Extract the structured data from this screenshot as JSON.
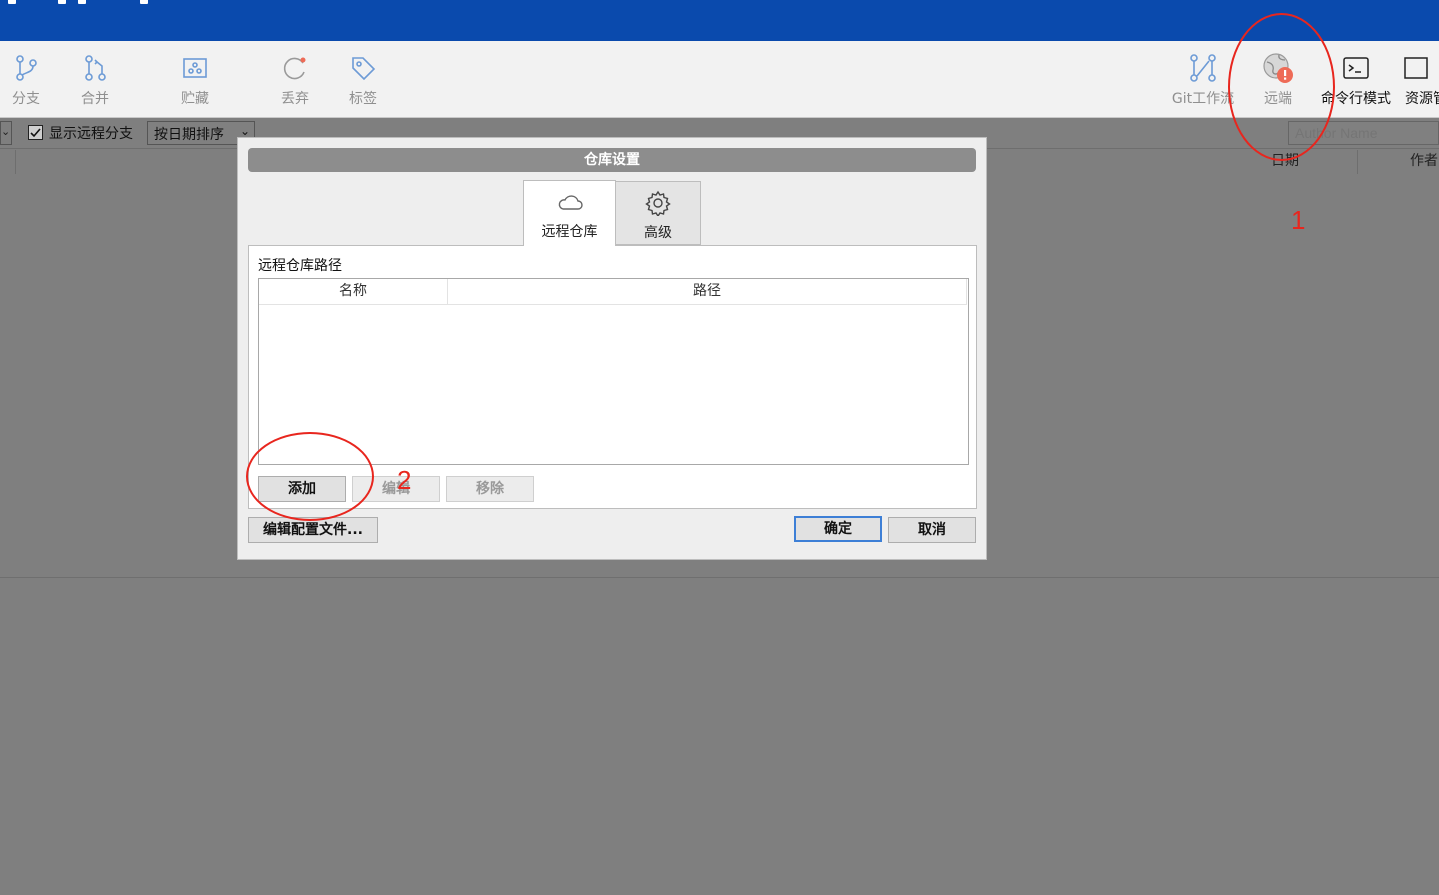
{
  "toolbar": {
    "items": [
      {
        "label": "分支",
        "icon": "branch-icon"
      },
      {
        "label": "合并",
        "icon": "merge-icon"
      },
      {
        "label": "贮藏",
        "icon": "stash-icon"
      },
      {
        "label": "丢弃",
        "icon": "discard-icon"
      },
      {
        "label": "标签",
        "icon": "tag-icon"
      },
      {
        "label": "Git工作流",
        "icon": "git-flow-icon"
      },
      {
        "label": "远端",
        "icon": "remote-globe-icon"
      },
      {
        "label": "命令行模式",
        "icon": "terminal-icon"
      },
      {
        "label": "资源管",
        "icon": "explorer-icon"
      }
    ]
  },
  "filter": {
    "show_remote_branches_label": "显示远程分支",
    "show_remote_branches_checked": true,
    "sort_selected": "按日期排序",
    "author_placeholder": "Author Name"
  },
  "columns": {
    "date": "日期",
    "author": "作者"
  },
  "dialog": {
    "title": "仓库设置",
    "tabs": [
      {
        "label": "远程仓库",
        "icon": "cloud-icon",
        "active": true
      },
      {
        "label": "高级",
        "icon": "gear-icon",
        "active": false
      }
    ],
    "section_heading": "远程仓库路径",
    "grid_headers": [
      "名称",
      "路径"
    ],
    "buttons": {
      "add": "添加",
      "edit": "编辑",
      "remove": "移除",
      "edit_config": "编辑配置文件...",
      "ok": "确定",
      "cancel": "取消"
    }
  },
  "annotations": {
    "step1": "1",
    "step2": "2"
  },
  "colors": {
    "titlebar": "#0a4aad",
    "annotation_red": "#e8261e",
    "badge_red": "#ee6b57"
  }
}
